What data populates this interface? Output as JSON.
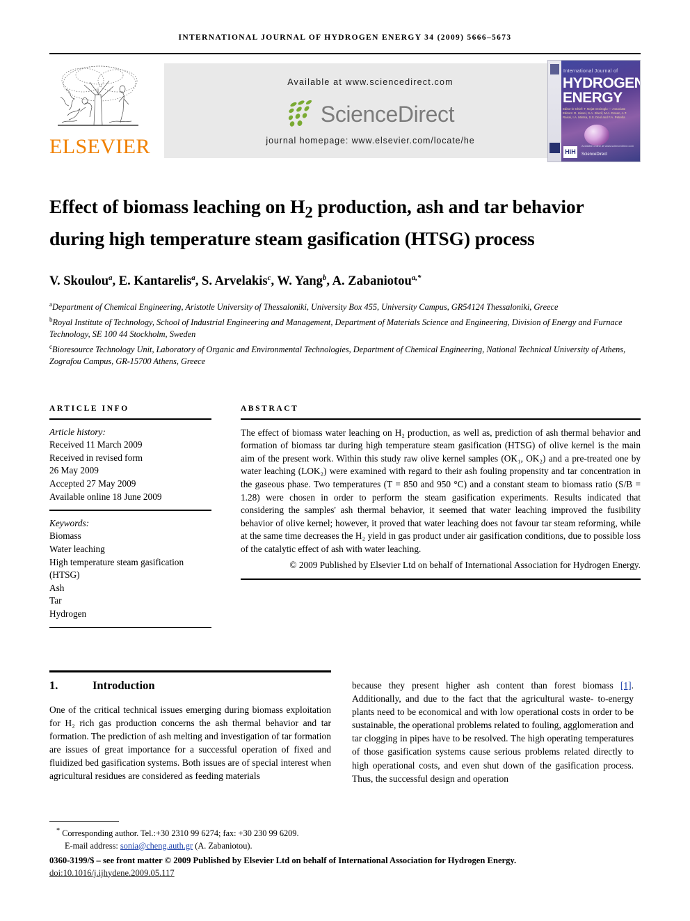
{
  "running_head": "INTERNATIONAL JOURNAL OF HYDROGEN ENERGY 34 (2009) 5666–5673",
  "masthead": {
    "publisher": "ELSEVIER",
    "available_at": "Available at www.sciencedirect.com",
    "sciencedirect_wordmark": "ScienceDirect",
    "journal_homepage": "journal homepage: www.elsevier.com/locate/he",
    "cover": {
      "superline": "International Journal of",
      "title_line1": "HYDROGEN",
      "title_line2": "ENERGY",
      "editors": "Editor-in-Chief: T. Nejat Veziroglu — Associate Editors: D. Hissel, S.A. Sherif, M.A. Rosen, A.T. Raissi, I.A. Mintsa, S.S. Deol and F.A. Petrella",
      "badge": "HiH",
      "sciencedirect_note": "Available online at www.sciencedirect.com",
      "sciencedirect_label": "ScienceDirect"
    }
  },
  "article": {
    "title": "Effect of biomass leaching on H₂ production, ash and tar behavior during high temperature steam gasification (HTSG) process",
    "title_part1": "Effect of biomass leaching on H",
    "title_sub": "2",
    "title_part2": " production, ash and tar behavior during high temperature steam gasification (HTSG) process",
    "authors_plain": "V. Skoulou a, E. Kantarelis a, S. Arvelakis c, W. Yang b, A. Zabaniotou a,*",
    "authors": [
      {
        "name": "V. Skoulou",
        "marks": "a"
      },
      {
        "name": "E. Kantarelis",
        "marks": "a"
      },
      {
        "name": "S. Arvelakis",
        "marks": "c"
      },
      {
        "name": "W. Yang",
        "marks": "b"
      },
      {
        "name": "A. Zabaniotou",
        "marks": "a,*"
      }
    ],
    "affiliations": [
      {
        "mark": "a",
        "text": "Department of Chemical Engineering, Aristotle University of Thessaloniki, University Box 455, University Campus, GR54124 Thessaloniki, Greece"
      },
      {
        "mark": "b",
        "text": "Royal Institute of Technology, School of Industrial Engineering and Management, Department of Materials Science and Engineering, Division of Energy and Furnace Technology, SE 100 44 Stockholm, Sweden"
      },
      {
        "mark": "c",
        "text": "Bioresource Technology Unit, Laboratory of Organic and Environmental Technologies, Department of Chemical Engineering, National Technical University of Athens, Zografou Campus, GR-15700 Athens, Greece"
      }
    ]
  },
  "article_info": {
    "label": "ARTICLE INFO",
    "history_label": "Article history:",
    "history": [
      "Received 11 March 2009",
      "Received in revised form",
      "26 May 2009",
      "Accepted 27 May 2009",
      "Available online 18 June 2009"
    ],
    "keywords_label": "Keywords:",
    "keywords": [
      "Biomass",
      "Water leaching",
      "High temperature steam gasification",
      "(HTSG)",
      "Ash",
      "Tar",
      "Hydrogen"
    ]
  },
  "abstract": {
    "label": "ABSTRACT",
    "text": "The effect of biomass water leaching on H₂ production, as well as, prediction of ash thermal behavior and formation of biomass tar during high temperature steam gasification (HTSG) of olive kernel is the main aim of the present work. Within this study raw olive kernel samples (OK₁, OK₂) and a pre-treated one by water leaching (LOK₂) were examined with regard to their ash fouling propensity and tar concentration in the gaseous phase. Two temperatures (T = 850 and 950 °C) and a constant steam to biomass ratio (S/B = 1.28) were chosen in order to perform the steam gasification experiments. Results indicated that considering the samples' ash thermal behavior, it seemed that water leaching improved the fusibility behavior of olive kernel; however, it proved that water leaching does not favour tar steam reforming, while at the same time decreases the H₂ yield in gas product under air gasification conditions, due to possible loss of the catalytic effect of ash with water leaching.",
    "copyright": "© 2009 Published by Elsevier Ltd on behalf of International Association for Hydrogen Energy."
  },
  "body": {
    "section_number": "1.",
    "section_title": "Introduction",
    "left_paragraph": "One of the critical technical issues emerging during biomass exploitation for H₂ rich gas production concerns the ash thermal behavior and tar formation. The prediction of ash melting and investigation of tar formation are issues of great importance for a successful operation of fixed and fluidized bed gasification systems. Both issues are of special interest when agricultural residues are considered as feeding materials",
    "right_paragraph_a": "because they present higher ash content than forest biomass ",
    "right_reference": "[1]",
    "right_paragraph_b": ". Additionally, and due to the fact that the agricultural waste- to-energy plants need to be economical and with low operational costs in order to be sustainable, the operational problems related to fouling, agglomeration and tar clogging in pipes have to be resolved. The high operating temperatures of those gasification systems cause serious problems related directly to high operational costs, and even shut down of the gasification process. Thus, the successful design and operation"
  },
  "footer": {
    "corresponding_mark": "*",
    "corresponding": "Corresponding author. Tel.:+30 2310 99 6274; fax: +30 230 99 6209.",
    "email_label": "E-mail address:",
    "email": "sonia@cheng.auth.gr",
    "email_owner": "(A. Zabaniotou).",
    "issn_line": "0360-3199/$ – see front matter © 2009 Published by Elsevier Ltd on behalf of International Association for Hydrogen Energy.",
    "doi": "doi:10.1016/j.ijhydene.2009.05.117"
  },
  "colors": {
    "elsevier_orange": "#F08000",
    "sciencedirect_green": "#7aaa32",
    "sciencedirect_gray": "#7b7b7b",
    "banner_gray": "#e9e9e9",
    "link_blue": "#1a3faa",
    "cover_purple": "#5a3f92"
  }
}
